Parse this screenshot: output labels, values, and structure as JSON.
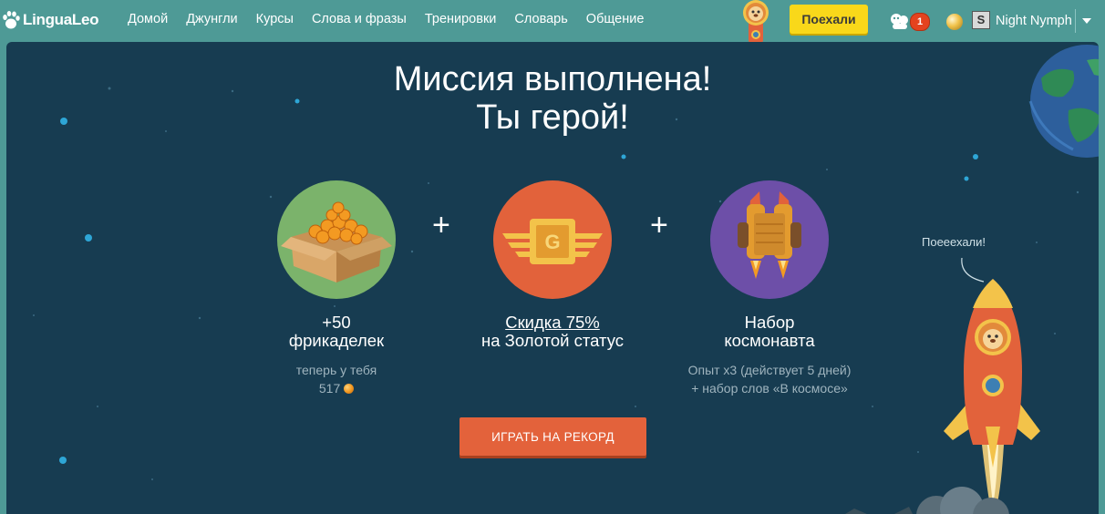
{
  "header": {
    "logo_text": "LinguaLeo",
    "nav": [
      "Домой",
      "Джунгли",
      "Курсы",
      "Слова и фразы",
      "Тренировки",
      "Словарь",
      "Общение"
    ],
    "go_button": "Поехали",
    "notification_count": "1",
    "avatar_letter": "S",
    "username": "Night Nymph"
  },
  "main": {
    "title_line1": "Миссия выполнена!",
    "title_line2": "Ты герой!",
    "plus_sign": "+",
    "rewards": [
      {
        "line1": "+50",
        "line2": "фрикаделек",
        "sub1": "теперь у тебя",
        "sub2": "517",
        "icon": "meatball-box-icon",
        "color": "#7bb36b"
      },
      {
        "link": "Скидка 75%",
        "line2": "на Золотой статус",
        "icon": "gold-badge-icon",
        "color": "#e2623b"
      },
      {
        "line1": "Набор",
        "line2": "космонавта",
        "sub1": "Опыт х3 (действует 5 дней)",
        "sub2": "+ набор слов «В космосе»",
        "icon": "jetpack-icon",
        "color": "#6d4fa8"
      }
    ],
    "play_button": "ИГРАТЬ НА РЕКОРД",
    "speech_text": "Поееехали!"
  },
  "colors": {
    "nav_bg": "#4e9a96",
    "panel_bg": "#173c51",
    "accent_orange": "#e3623b",
    "go_yellow": "#f9d81a"
  }
}
